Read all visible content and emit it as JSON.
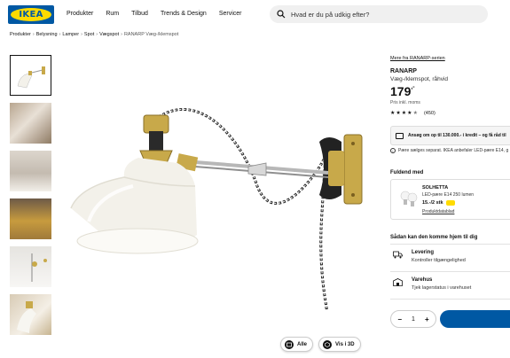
{
  "header": {
    "logo_text": "IKEA",
    "nav": [
      "Produkter",
      "Rum",
      "Tilbud",
      "Trends & Design",
      "Servicer"
    ],
    "search_placeholder": "Hvad er du på udkig efter?"
  },
  "breadcrumb": [
    "Produkter",
    "Belysning",
    "Lamper",
    "Spot",
    "Vægspot",
    "RANARP Væg-/klemspot"
  ],
  "gallery": {
    "buttons": {
      "all": "Alle",
      "view3d": "Vis i 3D"
    }
  },
  "product": {
    "series_link": "Mere fra RANARP-serien",
    "name": "RANARP",
    "description": "Væg-/klemspot, råhvid",
    "price": "179",
    "price_suffix": ",-",
    "price_note": "Pris inkl. moms",
    "rating_stars": 4.5,
    "rating_count": "(450)"
  },
  "credit": {
    "text": "Ansøg om op til 130.000.- i kredit – og få råd til"
  },
  "bulb_note": "Pære sælges separat. IKEA anbefaler LED-pære E14, g",
  "complete": {
    "title": "Fuldend med",
    "item_name": "SOLHETTA",
    "item_desc": "LED-pære E14 250 lumen",
    "item_price": "15.-/2 stk",
    "item_link": "Produktdatablad"
  },
  "delivery": {
    "title": "Sådan kan den komme hjem til dig",
    "levering_title": "Levering",
    "levering_sub": "Kontroller tilgængelighed",
    "varehus_title": "Varehus",
    "varehus_sub": "Tjek lagerstatus i varehuset"
  },
  "cart": {
    "quantity": "1",
    "minus": "−",
    "plus": "+"
  },
  "colors": {
    "brand_blue": "#0058a3",
    "brand_yellow": "#ffdb00",
    "brass": "#c8a94a"
  }
}
